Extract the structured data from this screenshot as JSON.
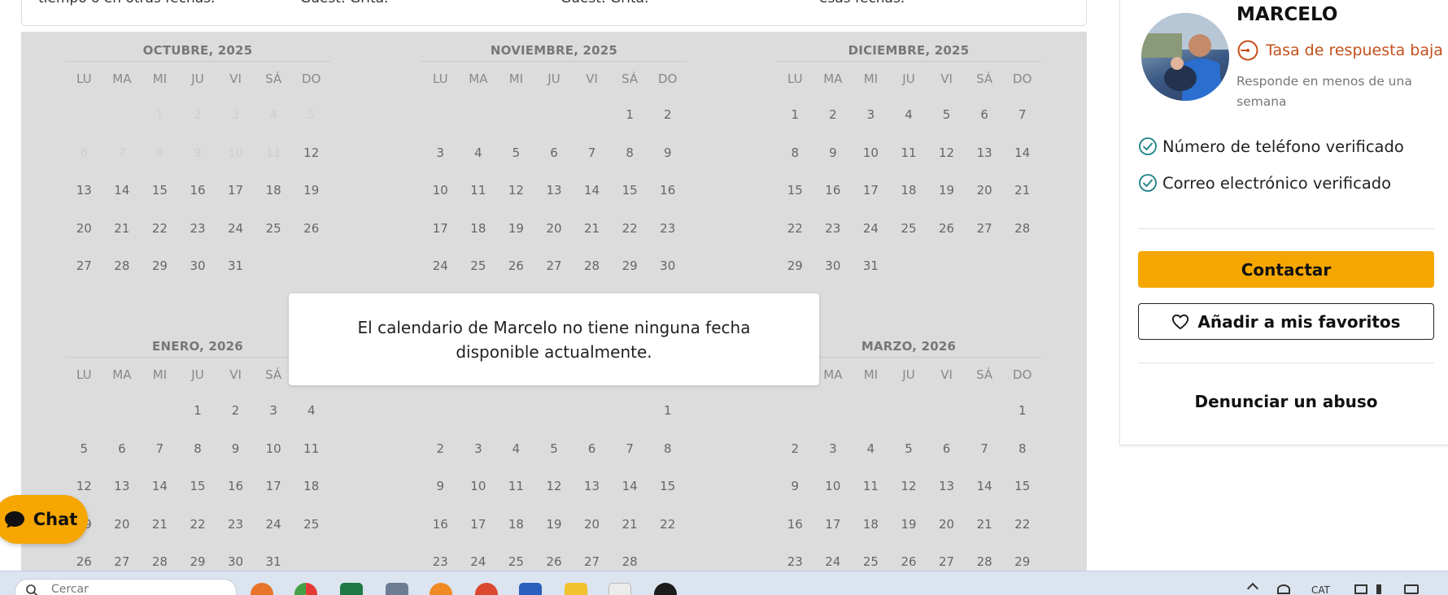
{
  "top_card": {
    "col1": "tiempo o en otras fechas.",
    "col2": "Guest: Grita.",
    "col3": "Guest: Grita.",
    "col4": "esas fechas."
  },
  "calendar": {
    "weekdays": [
      "LU",
      "MA",
      "MI",
      "JU",
      "VI",
      "SÁ",
      "DO"
    ],
    "months": [
      {
        "title": "OCTUBRE, 2025",
        "days": [
          "",
          "",
          "1",
          "2",
          "3",
          "4",
          "5",
          "6",
          "7",
          "8",
          "9",
          "10",
          "11",
          "12",
          "13",
          "14",
          "15",
          "16",
          "17",
          "18",
          "19",
          "20",
          "21",
          "22",
          "23",
          "24",
          "25",
          "26",
          "27",
          "28",
          "29",
          "30",
          "31"
        ],
        "past_until": 11
      },
      {
        "title": "NOVIEMBRE, 2025",
        "days": [
          "",
          "",
          "",
          "",
          "",
          "1",
          "2",
          "3",
          "4",
          "5",
          "6",
          "7",
          "8",
          "9",
          "10",
          "11",
          "12",
          "13",
          "14",
          "15",
          "16",
          "17",
          "18",
          "19",
          "20",
          "21",
          "22",
          "23",
          "24",
          "25",
          "26",
          "27",
          "28",
          "29",
          "30"
        ],
        "past_until": 0
      },
      {
        "title": "DICIEMBRE, 2025",
        "days": [
          "1",
          "2",
          "3",
          "4",
          "5",
          "6",
          "7",
          "8",
          "9",
          "10",
          "11",
          "12",
          "13",
          "14",
          "15",
          "16",
          "17",
          "18",
          "19",
          "20",
          "21",
          "22",
          "23",
          "24",
          "25",
          "26",
          "27",
          "28",
          "29",
          "30",
          "31"
        ],
        "past_until": 0
      },
      {
        "title": "ENERO, 2026",
        "days": [
          "",
          "",
          "",
          "1",
          "2",
          "3",
          "4",
          "5",
          "6",
          "7",
          "8",
          "9",
          "10",
          "11",
          "12",
          "13",
          "14",
          "15",
          "16",
          "17",
          "18",
          "19",
          "20",
          "21",
          "22",
          "23",
          "24",
          "25",
          "26",
          "27",
          "28",
          "29",
          "30",
          "31"
        ],
        "past_until": 0
      },
      {
        "title": "",
        "days": [
          "",
          "",
          "",
          "",
          "",
          "",
          "1",
          "2",
          "3",
          "4",
          "5",
          "6",
          "7",
          "8",
          "9",
          "10",
          "11",
          "12",
          "13",
          "14",
          "15",
          "16",
          "17",
          "18",
          "19",
          "20",
          "21",
          "22",
          "23",
          "24",
          "25",
          "26",
          "27",
          "28"
        ],
        "past_until": 0
      },
      {
        "title": "MARZO, 2026",
        "days": [
          "",
          "",
          "",
          "",
          "",
          "",
          "1",
          "2",
          "3",
          "4",
          "5",
          "6",
          "7",
          "8",
          "9",
          "10",
          "11",
          "12",
          "13",
          "14",
          "15",
          "16",
          "17",
          "18",
          "19",
          "20",
          "21",
          "22",
          "23",
          "24",
          "25",
          "26",
          "27",
          "28",
          "29"
        ],
        "past_until": 0
      }
    ]
  },
  "message": "El calendario de Marcelo no tiene ninguna fecha disponible actualmente.",
  "host": {
    "name": "MARCELO",
    "response_rate": "Tasa de respuesta baja",
    "response_time": "Responde en menos de una semana",
    "verifications": [
      "Número de teléfono verificado",
      "Correo electrónico verificado"
    ],
    "contact_label": "Contactar",
    "favorite_label": "Añadir a mis favoritos",
    "report_label": "Denunciar un abuso"
  },
  "chat_label": "Chat",
  "taskbar": {
    "search_placeholder": "Cercar",
    "language": "CAT"
  },
  "colors": {
    "accent": "#f5a600",
    "warning": "#c4501b",
    "verified": "#1a7f86",
    "calendar_bg": "#dcdcdc"
  }
}
